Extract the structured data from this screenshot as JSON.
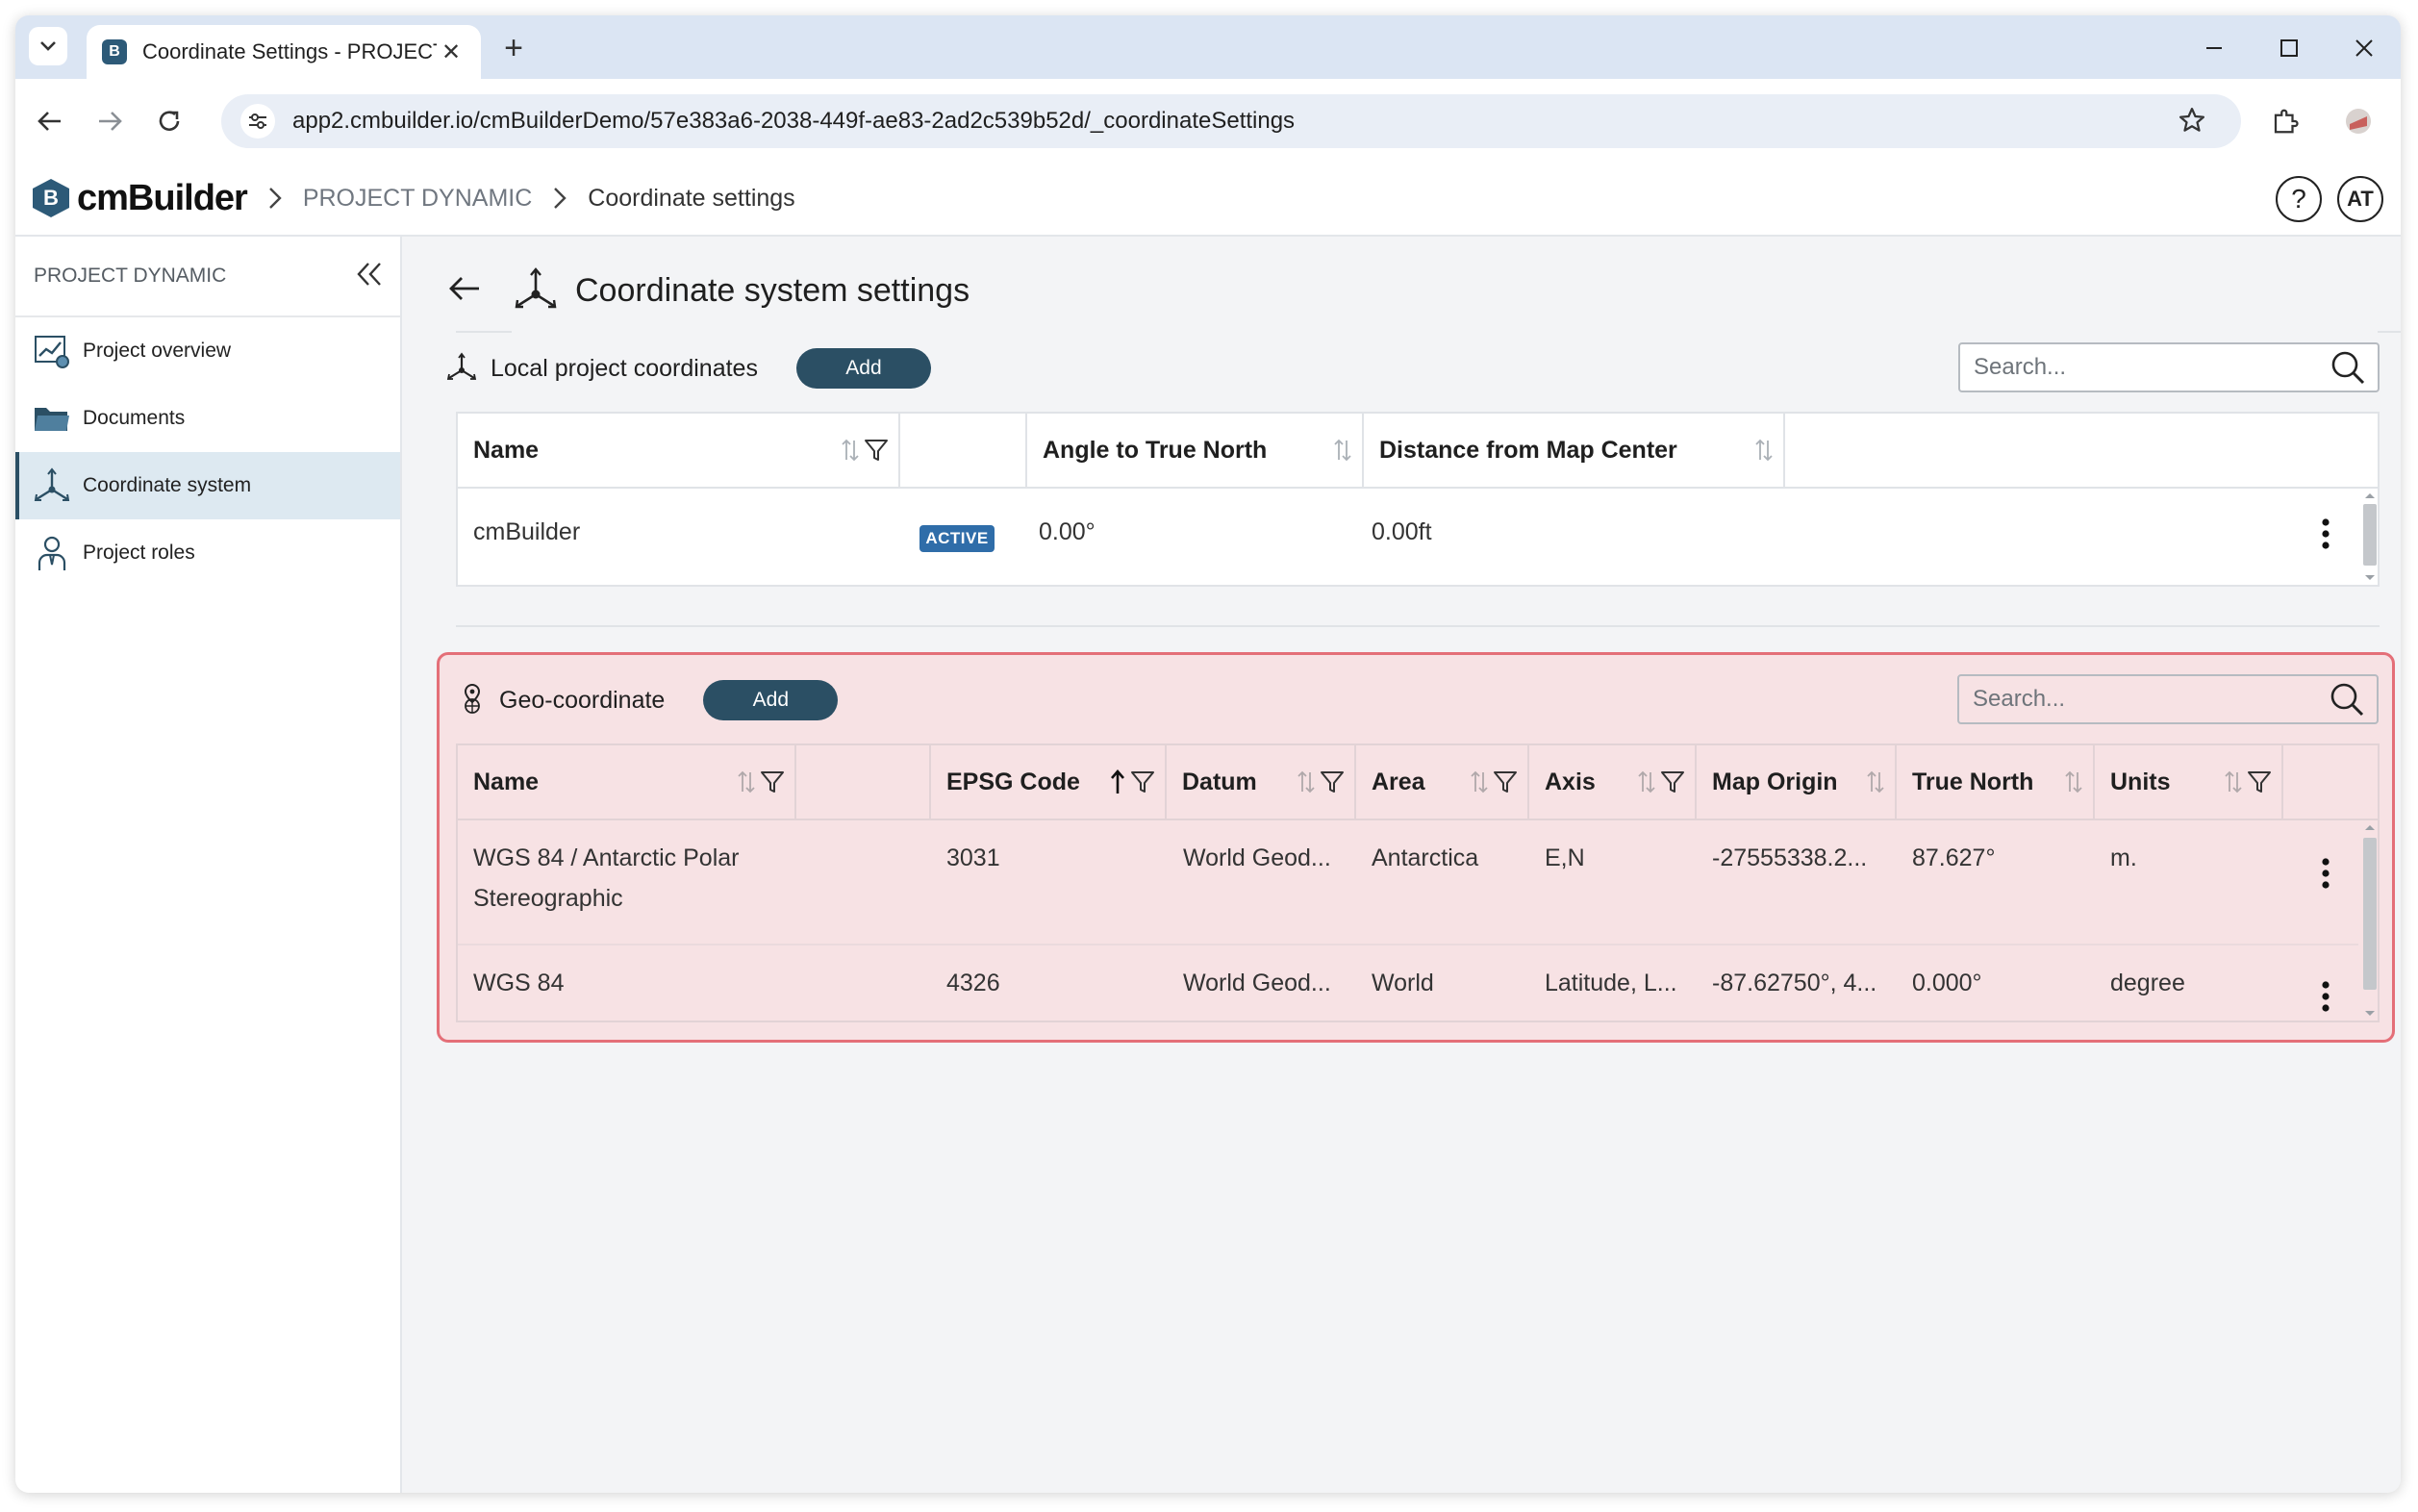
{
  "browser": {
    "tab_title": "Coordinate Settings - PROJECT",
    "new_tab_label": "+",
    "url": "app2.cmbuilder.io/cmBuilderDemo/57e383a6-2038-449f-ae83-2ad2c539b52d/_coordinateSettings"
  },
  "app": {
    "logo_text": "cmBuilder",
    "logo_mark": "B",
    "breadcrumb": [
      "PROJECT DYNAMIC",
      "Coordinate settings"
    ],
    "help_label": "?",
    "user_initials": "AT"
  },
  "sidebar": {
    "project_name": "PROJECT DYNAMIC",
    "items": [
      {
        "label": "Project overview",
        "icon": "chart-icon"
      },
      {
        "label": "Documents",
        "icon": "folder-icon"
      },
      {
        "label": "Coordinate system",
        "icon": "axes-icon",
        "active": true
      },
      {
        "label": "Project roles",
        "icon": "person-icon"
      }
    ]
  },
  "page": {
    "title": "Coordinate system settings"
  },
  "local": {
    "title": "Local project coordinates",
    "add_label": "Add",
    "search_placeholder": "Search...",
    "columns": [
      "Name",
      "Angle to True North",
      "Distance from Map Center"
    ],
    "rows": [
      {
        "name": "cmBuilder",
        "badge": "ACTIVE",
        "angle": "0.00°",
        "distance": "0.00ft"
      }
    ]
  },
  "geo": {
    "title": "Geo-coordinate",
    "add_label": "Add",
    "search_placeholder": "Search...",
    "columns": [
      "Name",
      "EPSG Code",
      "Datum",
      "Area",
      "Axis",
      "Map Origin",
      "True North",
      "Units"
    ],
    "rows": [
      {
        "name_line1": "WGS 84 / Antarctic Polar",
        "name_line2": "Stereographic",
        "epsg": "3031",
        "datum": "World Geod...",
        "area": "Antarctica",
        "axis": "E,N",
        "origin": "-27555338.2...",
        "true_north": "87.627°",
        "units": "m."
      },
      {
        "name_line1": "WGS 84",
        "name_line2": "",
        "epsg": "4326",
        "datum": "World Geod...",
        "area": "World",
        "axis": "Latitude, L...",
        "origin": "-87.62750°, 4...",
        "true_north": "0.000°",
        "units": "degree"
      }
    ]
  },
  "colors": {
    "accent": "#2b4f64",
    "active_badge": "#2f6da9",
    "highlight_border": "#e46f78",
    "highlight_fill": "#f7e2e4"
  }
}
